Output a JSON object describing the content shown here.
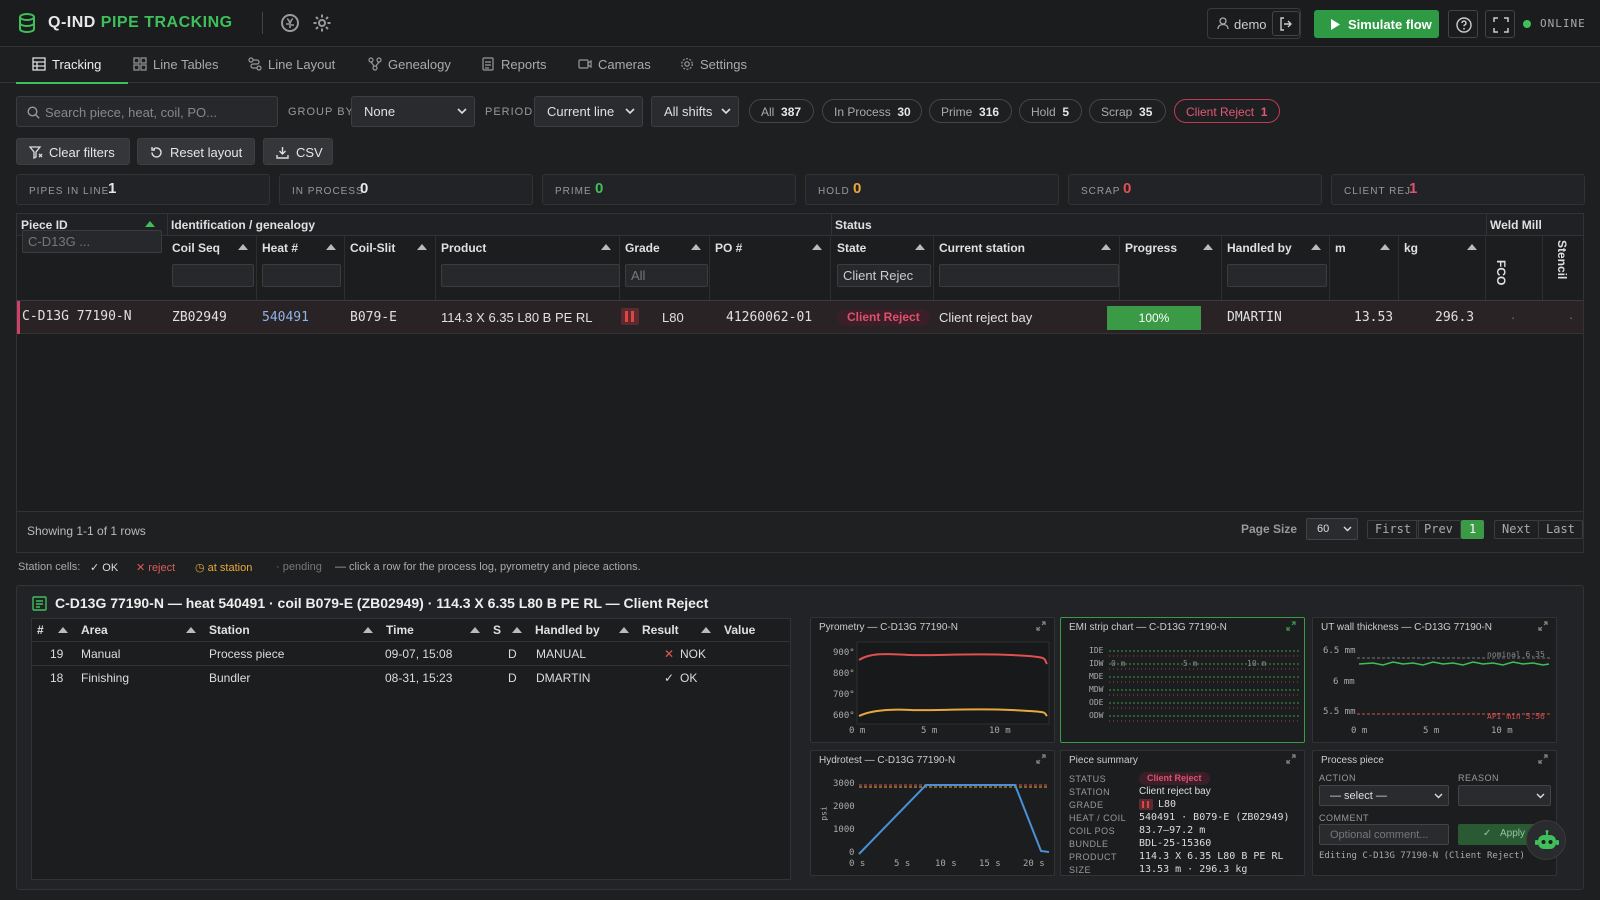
{
  "header": {
    "title_main": "Q-IND",
    "title_accent": "PIPE TRACKING",
    "user": "demo",
    "simulate_label": "Simulate flow",
    "status": "ONLINE",
    "colors": {
      "accent": "#3fbf5a",
      "reject": "#e0506e"
    }
  },
  "tabs": [
    {
      "label": "Tracking",
      "icon": "table-icon",
      "active": true
    },
    {
      "label": "Line Tables",
      "icon": "grid-icon"
    },
    {
      "label": "Line Layout",
      "icon": "layout-icon"
    },
    {
      "label": "Genealogy",
      "icon": "genealogy-icon"
    },
    {
      "label": "Reports",
      "icon": "report-icon"
    },
    {
      "label": "Cameras",
      "icon": "camera-icon"
    },
    {
      "label": "Settings",
      "icon": "gear-icon"
    }
  ],
  "filters": {
    "search_placeholder": "Search piece, heat, coil, PO...",
    "group_by_label": "GROUP BY",
    "group_by_value": "None",
    "period_label": "PERIOD",
    "period_value": "Current line",
    "shifts_value": "All shifts",
    "pills": [
      {
        "label": "All",
        "count": "387"
      },
      {
        "label": "In Process",
        "count": "30"
      },
      {
        "label": "Prime",
        "count": "316"
      },
      {
        "label": "Hold",
        "count": "5"
      },
      {
        "label": "Scrap",
        "count": "35"
      },
      {
        "label": "Client Reject",
        "count": "1"
      }
    ]
  },
  "actions": {
    "clear": "Clear filters",
    "reset": "Reset layout",
    "csv": "CSV"
  },
  "stats": [
    {
      "label": "PIPES IN LINE",
      "value": "1",
      "color": "#e6e6e6"
    },
    {
      "label": "IN PROCESS",
      "value": "0",
      "color": "#e6e6e6"
    },
    {
      "label": "PRIME",
      "value": "0",
      "color": "#3fbf5a"
    },
    {
      "label": "HOLD",
      "value": "0",
      "color": "#e8a93a"
    },
    {
      "label": "SCRAP",
      "value": "0",
      "color": "#e05050"
    },
    {
      "label": "CLIENT REJ",
      "value": "1",
      "color": "#e0506e"
    }
  ],
  "grid": {
    "groups": {
      "piece": "Piece ID",
      "ident": "Identification / genealogy",
      "status": "Status",
      "weld": "Weld Mill"
    },
    "columns": {
      "piece_filter": "C-D13G ...",
      "coil_seq": "Coil Seq",
      "heat": "Heat #",
      "coil_slit": "Coil-Slit",
      "product": "Product",
      "grade": "Grade",
      "grade_filter": "All",
      "po": "PO #",
      "state": "State",
      "state_filter": "Client Rejec",
      "station": "Current station",
      "progress": "Progress",
      "handled": "Handled by",
      "m": "m",
      "kg": "kg",
      "fco": "FCO",
      "stencil": "Stencil"
    },
    "row": {
      "piece_id": "C-D13G 77190-N",
      "coil_seq": "ZB02949",
      "heat": "540491",
      "coil_slit": "B079-E",
      "product": "114.3 X 6.35 L80 B PE RL",
      "grade": "L80",
      "po": "41260062-01",
      "state": "Client Reject",
      "station": "Client reject bay",
      "progress": "100%",
      "handled": "DMARTIN",
      "m": "13.53",
      "kg": "296.3",
      "fco": "·",
      "stencil": "·"
    },
    "footer": {
      "showing": "Showing 1-1 of 1 rows",
      "page_size_label": "Page Size",
      "page_size": "60",
      "first": "First",
      "prev": "Prev",
      "page": "1",
      "next": "Next",
      "last": "Last"
    }
  },
  "legend": {
    "prefix": "Station cells:",
    "ok": "OK",
    "reject": "reject",
    "at_station": "at station",
    "pending": "pending",
    "hint": "— click a row for the process log, pyrometry and piece actions."
  },
  "detail": {
    "title": "C-D13G 77190-N — heat 540491 · coil B079-E (ZB02949) · 114.3 X 6.35 L80 B PE RL — Client Reject",
    "log_headers": [
      "#",
      "Area",
      "Station",
      "Time",
      "S",
      "Handled by",
      "Result",
      "Value"
    ],
    "log_rows": [
      {
        "n": "19",
        "area": "Manual",
        "station": "Process piece",
        "time": "09-07, 15:08",
        "s": "D",
        "by": "MANUAL",
        "result": "NOK"
      },
      {
        "n": "18",
        "area": "Finishing",
        "station": "Bundler",
        "time": "08-31, 15:23",
        "s": "D",
        "by": "DMARTIN",
        "result": "OK"
      }
    ],
    "pyrometry": {
      "title": "Pyrometry — C-D13G 77190-N",
      "yticks": [
        "900°",
        "800°",
        "700°",
        "600°"
      ],
      "xticks": [
        "0 m",
        "5 m",
        "10 m"
      ]
    },
    "emi": {
      "title": "EMI strip chart — C-D13G 77190-N",
      "channels": [
        "IDE",
        "IDW",
        "MDE",
        "MDW",
        "ODE",
        "ODW"
      ],
      "xticks": [
        "0 m",
        "5 m",
        "10 m"
      ]
    },
    "ut": {
      "title": "UT wall thickness — C-D13G 77190-N",
      "yticks": [
        "6.5 mm",
        "6 mm",
        "5.5 mm"
      ],
      "xticks": [
        "0 m",
        "5 m",
        "10 m"
      ],
      "nominal": "nominal 6.35",
      "api_min": "API min 5.56"
    },
    "hydro": {
      "title": "Hydrotest — C-D13G 77190-N",
      "yticks": [
        "3000",
        "2000",
        "1000",
        "0"
      ],
      "xticks": [
        "0 s",
        "5 s",
        "10 s",
        "15 s",
        "20 s"
      ],
      "ylabel": "psi"
    },
    "summary": {
      "title": "Piece summary",
      "rows": [
        {
          "k": "STATUS",
          "v": "Client Reject"
        },
        {
          "k": "STATION",
          "v": "Client reject bay"
        },
        {
          "k": "GRADE",
          "v": "L80"
        },
        {
          "k": "HEAT / COIL",
          "v": "540491 · B079-E (ZB02949)"
        },
        {
          "k": "COIL POS",
          "v": "83.7–97.2 m"
        },
        {
          "k": "BUNDLE",
          "v": "BDL-25-15360"
        },
        {
          "k": "PRODUCT",
          "v": "114.3 X 6.35 L80 B PE RL"
        },
        {
          "k": "SIZE",
          "v": "13.53 m · 296.3 kg"
        }
      ]
    },
    "process": {
      "title": "Process piece",
      "action_label": "ACTION",
      "action_value": "— select —",
      "reason_label": "REASON",
      "reason_value": "",
      "comment_label": "COMMENT",
      "comment_placeholder": "Optional comment...",
      "apply": "Apply",
      "editing": "Editing C-D13G 77190-N (Client Reject)"
    }
  }
}
